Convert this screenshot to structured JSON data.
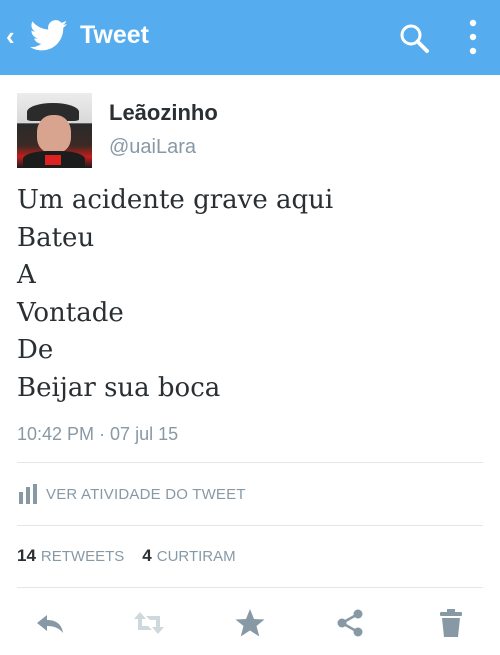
{
  "topbar": {
    "back_glyph": "‹",
    "title": "Tweet",
    "brand_color": "#55acee",
    "icons": [
      "chevron-left-icon",
      "twitter-bird-icon",
      "search-icon",
      "more-vertical-icon"
    ]
  },
  "user": {
    "display_name": "Leãozinho",
    "handle": "@uaiLara"
  },
  "tweet": {
    "lines": [
      "Um acidente grave aqui",
      "Bateu",
      "A",
      "Vontade",
      "De",
      "Beijar sua boca"
    ],
    "timestamp": "10:42 PM · 07 jul 15"
  },
  "activity": {
    "label": "VER ATIVIDADE DO TWEET",
    "icon": "bar-chart-icon"
  },
  "stats": {
    "retweets_count": "14",
    "retweets_label": "RETWEETS",
    "likes_count": "4",
    "likes_label": "CURTIRAM"
  },
  "actions": {
    "icons": [
      "reply-icon",
      "retweet-icon",
      "favorite-star-icon",
      "share-icon",
      "delete-trash-icon"
    ],
    "icon_color": "#8899a6"
  }
}
